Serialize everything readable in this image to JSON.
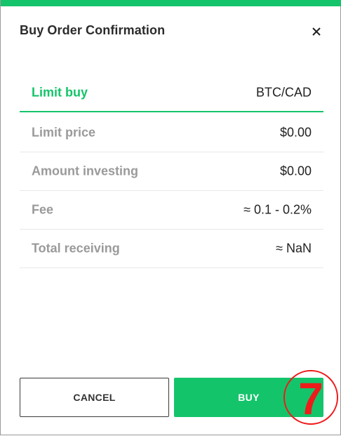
{
  "dialog": {
    "title": "Buy Order Confirmation",
    "close_icon": "close-icon"
  },
  "summary": {
    "order_type": "Limit buy",
    "pair": "BTC/CAD",
    "rows": [
      {
        "label": "Limit price",
        "value": "$0.00"
      },
      {
        "label": "Amount investing",
        "value": "$0.00"
      },
      {
        "label": "Fee",
        "value": "≈ 0.1 - 0.2%"
      },
      {
        "label": "Total receiving",
        "value": "≈ NaN"
      }
    ]
  },
  "actions": {
    "cancel_label": "CANCEL",
    "buy_label": "BUY"
  },
  "annotation": {
    "marker_label": "7"
  },
  "colors": {
    "accent": "#14c46a",
    "marker": "#ee1b1b",
    "muted_label": "#9a9a9a"
  }
}
